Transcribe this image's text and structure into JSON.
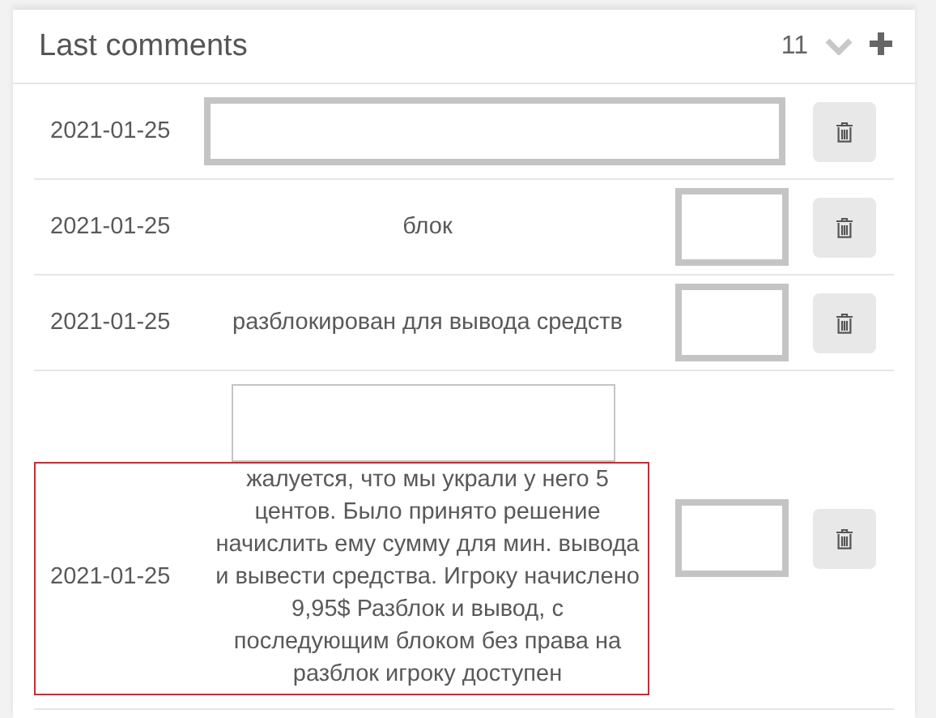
{
  "panel": {
    "title": "Last comments",
    "count": "11"
  },
  "comments": [
    {
      "date": "2021-01-25",
      "frames": [
        {
          "kind": "wide"
        }
      ]
    },
    {
      "date": "2021-01-25",
      "text": "блок",
      "frames": [
        {
          "kind": "square"
        }
      ]
    },
    {
      "date": "2021-01-25",
      "text": "разблокирован для вывода средств",
      "frames": [
        {
          "kind": "square"
        }
      ]
    },
    {
      "date": "2021-01-25",
      "text": "жалуется, что мы украли у него 5 центов. Было принято решение начислить ему сумму для мин. вывода и вывести средства. Игроку начислено 9,95$ Разблок и вывод, с последующим блоком без права на разблок игроку доступен",
      "highlighted": true,
      "frames": [
        {
          "kind": "thin"
        },
        {
          "kind": "square"
        }
      ]
    }
  ]
}
